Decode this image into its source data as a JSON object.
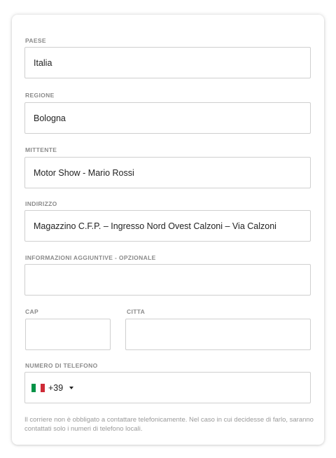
{
  "form": {
    "country": {
      "label": "PAESE",
      "value": "Italia"
    },
    "region": {
      "label": "REGIONE",
      "value": "Bologna"
    },
    "sender": {
      "label": "MITTENTE",
      "value": "Motor Show - Mario Rossi"
    },
    "address": {
      "label": "INDIRIZZO",
      "value": "Magazzino C.F.P. – Ingresso Nord Ovest Calzoni – Via Calzoni"
    },
    "extra_info": {
      "label": "INFORMAZIONI AGGIUNTIVE - OPZIONALE",
      "value": ""
    },
    "zip": {
      "label": "CAP",
      "value": ""
    },
    "city": {
      "label": "CITTA",
      "value": ""
    },
    "phone": {
      "label": "NUMERO DI TELEFONO",
      "prefix": "+39",
      "flag_icon": "italy-flag-icon",
      "flag_colors": [
        "#009246",
        "#ffffff",
        "#ce2b37"
      ],
      "value": ""
    },
    "note": "Il corriere non è obbligato a contattare telefonicamente. Nel caso in cui decidesse di farlo, saranno contattati solo i numeri di telefono locali."
  }
}
